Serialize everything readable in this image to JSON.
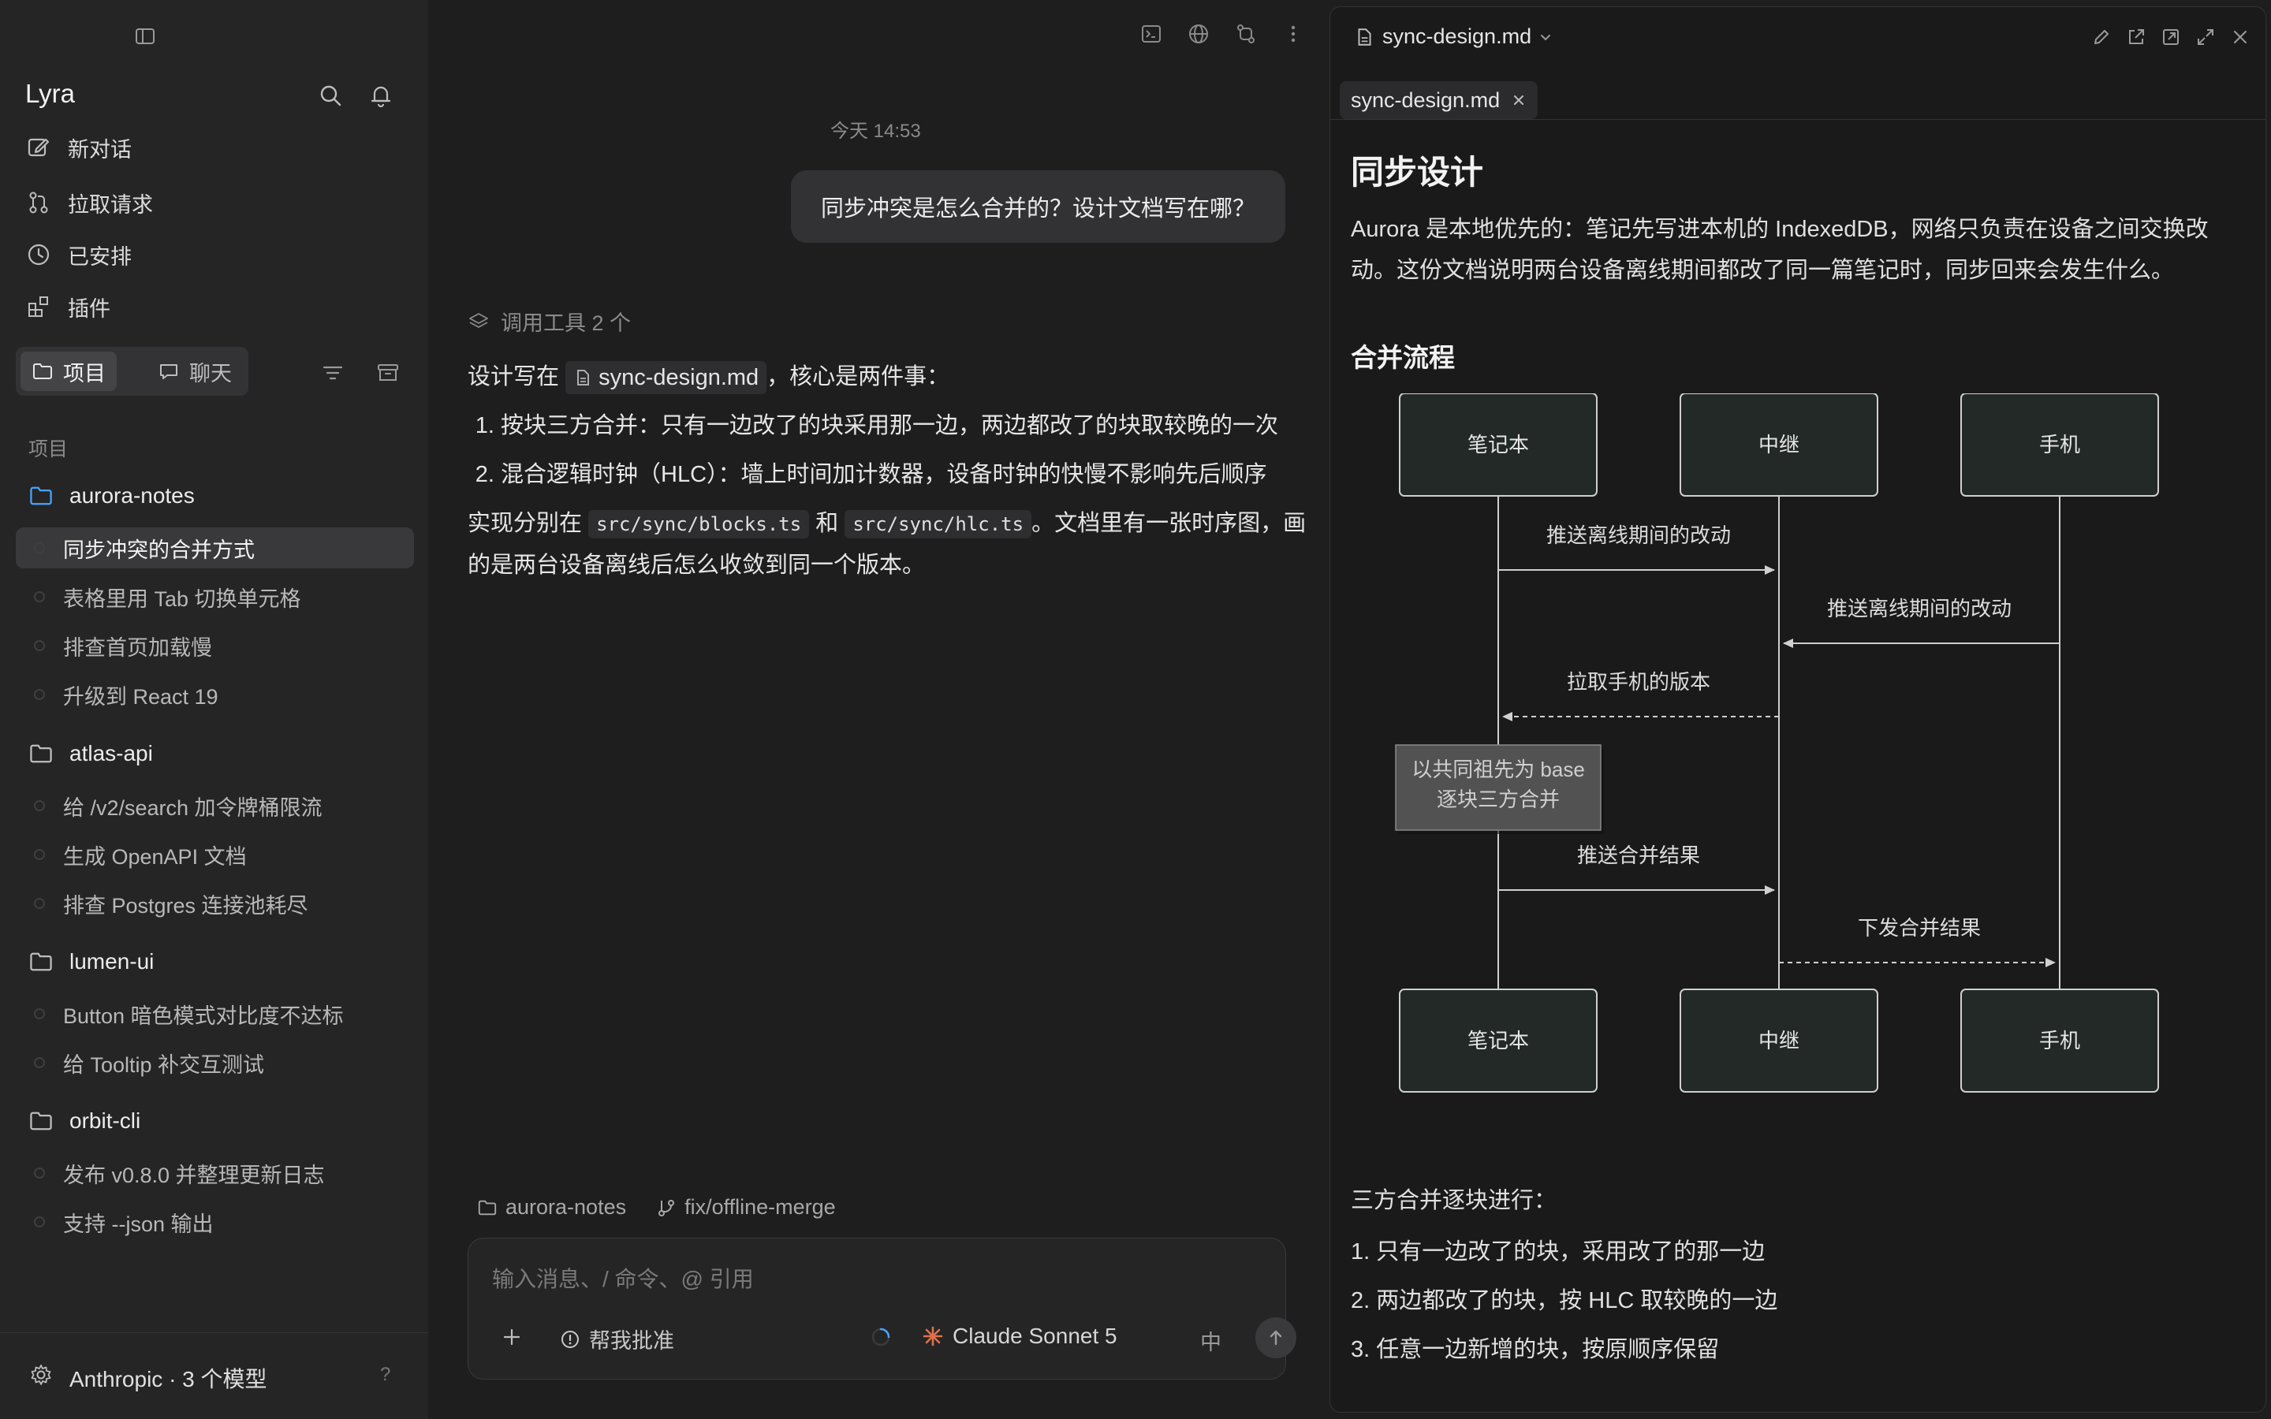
{
  "app": {
    "name": "Lyra"
  },
  "sidebar": {
    "nav": [
      {
        "label": "新对话",
        "icon": "edit-icon"
      },
      {
        "label": "拉取请求",
        "icon": "pull-request-icon"
      },
      {
        "label": "已安排",
        "icon": "clock-icon"
      },
      {
        "label": "插件",
        "icon": "puzzle-icon"
      }
    ],
    "segments": [
      {
        "label": "项目",
        "icon": "folder-icon",
        "active": true
      },
      {
        "label": "聊天",
        "icon": "chat-icon",
        "active": false
      }
    ],
    "section_label": "项目",
    "projects": [
      {
        "name": "aurora-notes",
        "chats": [
          "同步冲突的合并方式",
          "表格里用 Tab 切换单元格",
          "排查首页加载慢",
          "升级到 React 19"
        ]
      },
      {
        "name": "atlas-api",
        "chats": [
          "给 /v2/search 加令牌桶限流",
          "生成 OpenAPI 文档",
          "排查 Postgres 连接池耗尽"
        ]
      },
      {
        "name": "lumen-ui",
        "chats": [
          "Button 暗色模式对比度不达标",
          "给 Tooltip 补交互测试"
        ]
      },
      {
        "name": "orbit-cli",
        "chats": [
          "发布 v0.8.0 并整理更新日志",
          "支持 --json 输出"
        ]
      }
    ],
    "footer": {
      "provider": "Anthropic · 3 个模型",
      "help": "?"
    }
  },
  "chat": {
    "timestamp": "今天 14:53",
    "user_message": "同步冲突是怎么合并的？设计文档写在哪？",
    "tools_called": "调用工具 2 个",
    "answer": {
      "intro_before": "设计写在",
      "file_ref": "sync-design.md",
      "intro_after": "，核心是两件事：",
      "points": [
        "按块三方合并：只有一边改了的块采用那一边，两边都改了的块取较晚的一次",
        "混合逻辑时钟（HLC）：墙上时间加计数器，设备时钟的快慢不影响先后顺序"
      ],
      "impl_before": "实现分别在",
      "code1": "src/sync/blocks.ts",
      "impl_mid": "和",
      "code2": "src/sync/hlc.ts",
      "impl_after": "。文档里有一张时序图，画的是两台设备离线后怎么收敛到同一个版本。"
    },
    "context": {
      "project": "aurora-notes",
      "branch": "fix/offline-merge"
    },
    "composer": {
      "placeholder": "输入消息、/ 命令、@ 引用",
      "approve_label": "帮我批准",
      "model": "Claude Sonnet 5",
      "lang": "中"
    }
  },
  "doc": {
    "filename": "sync-design.md",
    "tab": "sync-design.md",
    "title": "同步设计",
    "intro": "Aurora 是本地优先的：笔记先写进本机的 IndexedDB，网络只负责在设备之间交换改动。这份文档说明两台设备离线期间都改了同一篇笔记时，同步回来会发生什么。",
    "section": "合并流程",
    "diagram": {
      "participants": [
        "笔记本",
        "中继",
        "手机"
      ],
      "messages": [
        {
          "from": 0,
          "to": 1,
          "label": "推送离线期间的改动",
          "dashed": false
        },
        {
          "from": 2,
          "to": 1,
          "label": "推送离线期间的改动",
          "dashed": false
        },
        {
          "from": 1,
          "to": 0,
          "label": "拉取手机的版本",
          "dashed": true
        },
        {
          "from": 0,
          "to": 1,
          "label": "推送合并结果",
          "dashed": false
        },
        {
          "from": 1,
          "to": 2,
          "label": "下发合并结果",
          "dashed": true
        }
      ],
      "note": [
        "以共同祖先为 base",
        "逐块三方合并"
      ]
    },
    "merge_title": "三方合并逐块进行：",
    "merge_rules": [
      "1. 只有一边改了的块，采用改了的那一边",
      "2. 两边都改了的块，按 HLC 取较晚的一边",
      "3. 任意一边新增的块，按原顺序保留"
    ]
  }
}
